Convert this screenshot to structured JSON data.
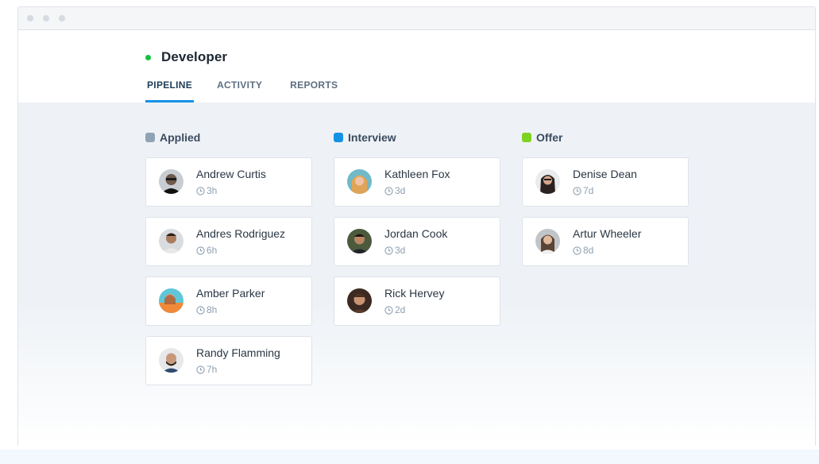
{
  "job": {
    "title": "Developer",
    "status_color": "#12c23b"
  },
  "tabs": [
    {
      "label": "PIPELINE",
      "active": true
    },
    {
      "label": "ACTIVITY",
      "active": false
    },
    {
      "label": "REPORTS",
      "active": false
    }
  ],
  "columns": [
    {
      "title": "Applied",
      "color": "#8fa3b3",
      "cards": [
        {
          "name": "Andrew Curtis",
          "time": "3h",
          "avatar_icon": "person-avatar"
        },
        {
          "name": "Andres Rodriguez",
          "time": "6h",
          "avatar_icon": "person-avatar"
        },
        {
          "name": "Amber Parker",
          "time": "8h",
          "avatar_icon": "person-avatar"
        },
        {
          "name": "Randy Flamming",
          "time": "7h",
          "avatar_icon": "person-avatar"
        }
      ]
    },
    {
      "title": "Interview",
      "color": "#1592e6",
      "cards": [
        {
          "name": "Kathleen Fox",
          "time": "3d",
          "avatar_icon": "person-avatar"
        },
        {
          "name": "Jordan Cook",
          "time": "3d",
          "avatar_icon": "person-avatar"
        },
        {
          "name": "Rick Hervey",
          "time": "2d",
          "avatar_icon": "person-avatar"
        }
      ]
    },
    {
      "title": "Offer",
      "color": "#7ed321",
      "cards": [
        {
          "name": "Denise Dean",
          "time": "7d",
          "avatar_icon": "person-avatar"
        },
        {
          "name": "Artur Wheeler",
          "time": "8d",
          "avatar_icon": "person-avatar"
        }
      ]
    }
  ]
}
